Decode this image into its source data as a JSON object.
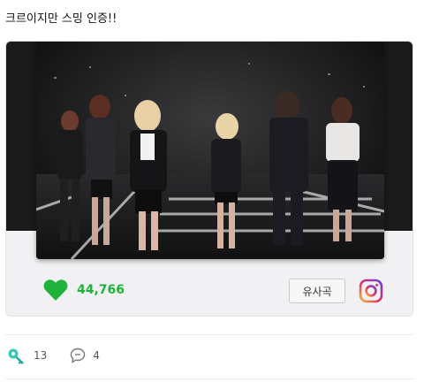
{
  "post": {
    "text": "크르이지만 스밍 인증!!"
  },
  "song_card": {
    "like_count": "44,766",
    "similar_label": "유사곡",
    "colors": {
      "like_green": "#1fb33b",
      "card_bg": "#f1f1f3"
    },
    "icons": {
      "like": "heart-icon",
      "share": "instagram-icon"
    }
  },
  "footer": {
    "likes": "13",
    "comments": "4",
    "icons": {
      "likes": "key-like-icon",
      "comments": "comment-icon"
    }
  }
}
